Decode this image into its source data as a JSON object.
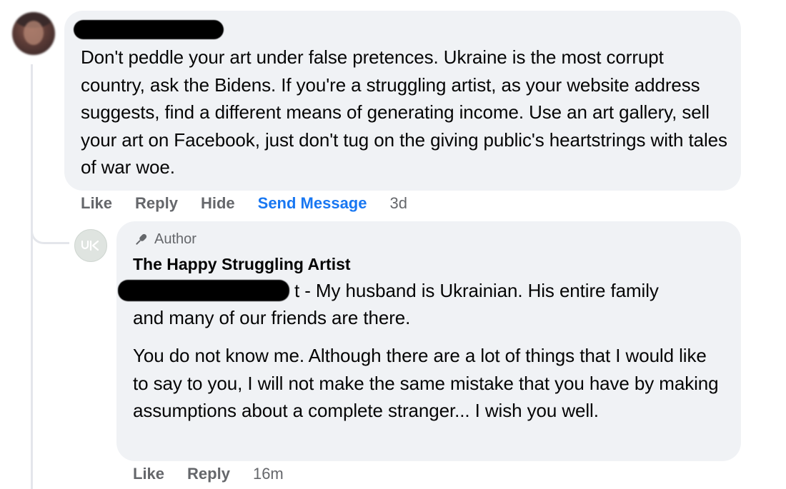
{
  "comment_1": {
    "author_name": "",
    "text": "Don't peddle your art under false pretences. Ukraine is the most corrupt country, ask the Bidens. If you're a struggling artist, as your website address suggests, find a different means of generating income. Use an art gallery, sell your art on Facebook, just don't tug on the giving public's heartstrings with tales of war woe.",
    "actions": {
      "like": "Like",
      "reply": "Reply",
      "hide": "Hide",
      "send_message": "Send Message",
      "time": "3d"
    }
  },
  "reply_1": {
    "badge": "Author",
    "author_name": "The Happy Struggling Artist",
    "mention_suffix": "t",
    "line1": "- My husband is Ukrainian. His entire family",
    "line2": "and many of our friends are there.",
    "paragraph2": "You do not know me. Although there are a lot of things that I would like to say to you, I will not make the same mistake that you have by making assumptions about a complete stranger... I wish you well.",
    "actions": {
      "like": "Like",
      "reply": "Reply",
      "time": "16m"
    }
  },
  "colors": {
    "bubble": "#f0f2f5",
    "action_gray": "#65676b",
    "link_blue": "#1877f2"
  }
}
